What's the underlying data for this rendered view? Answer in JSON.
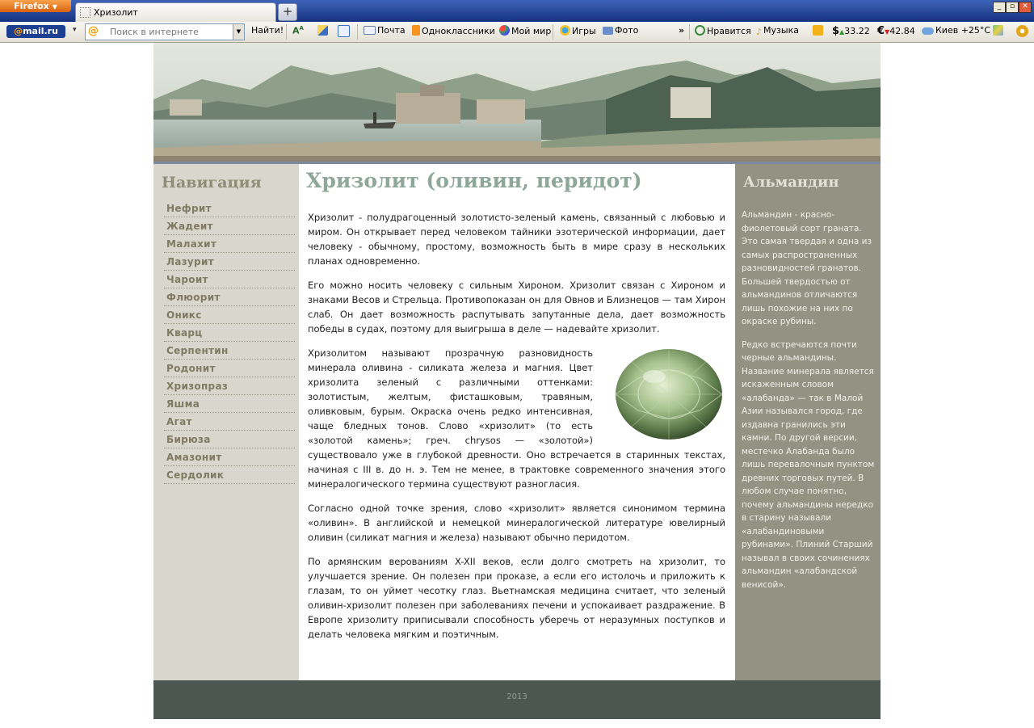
{
  "browser": {
    "menu_button": "Firefox",
    "tab_title": "Хризолит",
    "new_tab": "+",
    "window_controls": [
      "_",
      "▫",
      "✕"
    ]
  },
  "toolbar": {
    "logo_at": "@",
    "logo_text": "mail.ru",
    "search_placeholder": "Поиск в интернете",
    "search_button": "Найти!",
    "links": {
      "mail": "Почта",
      "odnoklassniki": "Одноклассники",
      "my_world": "Мой мир",
      "games": "Игры",
      "photo": "Фото",
      "more": "»",
      "like": "Нравится",
      "music": "Музыка"
    },
    "currency": {
      "usd_symbol": "$",
      "usd_value": "33.22",
      "eur_symbol": "€",
      "eur_value": "42.84"
    },
    "weather": "Киев +25°С"
  },
  "sidebar": {
    "title": "Навигация",
    "items": [
      "Нефрит",
      "Жадеит",
      "Малахит",
      "Лазурит",
      "Чароит",
      "Флюорит",
      "Оникс",
      "Кварц",
      "Серпентин",
      "Родонит",
      "Хризопраз",
      "Яшма",
      "Агат",
      "Бирюза",
      "Амазонит",
      "Сердолик"
    ]
  },
  "main": {
    "title": "Хризолит (оливин, перидот)",
    "paragraphs": [
      "Хризолит - полудрагоценный золотисто-зеленый камень, связанный с любовью и миром. Он открывает перед человеком тайники эзотерической информации, дает человеку - обычному, простому, возможность быть в мире сразу в нескольких планах одновременно.",
      "Его можно носить человеку с сильным Хироном. Хризолит связан с Хироном и знаками Весов и Стрельца. Противопоказан он для Овнов и Близнецов — там Хирон слаб. Он дает возможность распутывать запутанные дела, дает возможность победы в судах, поэтому для выигрыша в деле — надевайте хризолит.",
      "Хризолитом называют прозрачную разновидность минерала оливина - силиката железа и магния. Цвет хризолита зеленый с различными оттенками: золотистым, желтым, фисташковым, травяным, оливковым, бурым. Окраска очень редко интенсивная, чаще бледных тонов. Слово «хризолит» (то есть «золотой камень»; греч. chrysos — «золотой») существовало уже в глубокой древности. Оно встречается в старинных текстах, начиная с III в. до н. э. Тем не менее, в трактовке современного значения этого минералогического термина существуют разногласия.",
      "Согласно одной точке зрения, слово «хризолит» является синонимом термина «оливин». В английской и немецкой минералогической литературе ювелирный оливин (силикат магния и железа) называют обычно перидотом.",
      "По армянским верованиям X-XII веков, если долго смотреть на хризолит, то улучшается зрение. Он полезен при проказе, а если его истолочь и приложить к глазам, то он уймет чесотку глаз. Вьетнамская медицина считает, что зеленый оливин-хризолит полезен при заболеваниях печени и успокаивает раздражение. В Европе хризолиту приписывали способность уберечь от неразумных поступков и делать человека мягким и поэтичным."
    ]
  },
  "aside": {
    "title": "Альмандин",
    "paragraphs": [
      "Альмандин - красно-фиолетовый сорт граната. Это самая твердая и одна из самых распространенных разновидностей гранатов. Большей твердостью от альмандинов отличаются лишь похожие на них по окраске рубины.",
      "Редко встречаются почти черные альмандины. Название минерала является искаженным словом «алабанда» — так в Малой Азии назывался город, где издавна гранились эти камни. По другой версии, местечко Алабанда было лишь перевалочным пунктом древних торговых путей. В любом случае понятно, почему альмандины нередко в старину называли «алабандиновыми рубинами». Плиний Старший называл в своих сочинениях альмандин «алабандской венисой»."
    ]
  },
  "footer": {
    "year": "2013"
  },
  "colors": {
    "page_bg": "#d9d7cd",
    "heading": "#8ea79a",
    "nav_link": "#7f7a62",
    "right_sidebar": "#939283",
    "footer": "#4c5751"
  }
}
